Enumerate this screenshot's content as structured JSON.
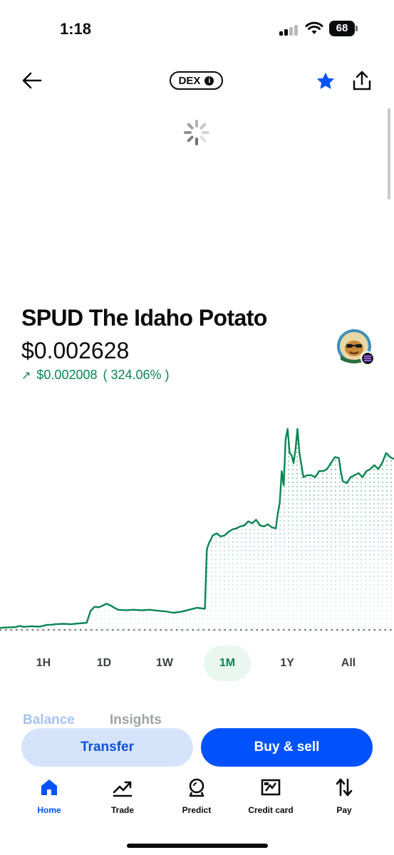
{
  "status_bar": {
    "time": "1:18",
    "battery": "68"
  },
  "header": {
    "badge_label": "DEX",
    "info_glyph": "i",
    "favorite_icon": "star-icon",
    "share_icon": "share-icon",
    "back_icon": "arrow-left-icon"
  },
  "token": {
    "name": "SPUD The Idaho Potato",
    "price": "$0.002628",
    "change_arrow": "↗",
    "change_amount": "$0.002008",
    "change_percent": "( 324.06% )",
    "logo_icon": "spud-token-logo-icon",
    "change_color": "#098551"
  },
  "chart_data": {
    "type": "area",
    "line_color": "#098551",
    "baseline": "dotted",
    "points": [
      [
        0,
        0.01
      ],
      [
        2,
        0.012
      ],
      [
        4,
        0.014
      ],
      [
        5,
        0.02
      ],
      [
        6,
        0.015
      ],
      [
        8,
        0.018
      ],
      [
        10,
        0.016
      ],
      [
        12,
        0.025
      ],
      [
        13,
        0.025
      ],
      [
        14,
        0.028
      ],
      [
        16,
        0.03
      ],
      [
        18,
        0.028
      ],
      [
        20,
        0.032
      ],
      [
        22,
        0.035
      ],
      [
        23,
        0.095
      ],
      [
        24,
        0.115
      ],
      [
        25,
        0.112
      ],
      [
        26,
        0.12
      ],
      [
        27,
        0.13
      ],
      [
        28,
        0.122
      ],
      [
        29,
        0.11
      ],
      [
        30,
        0.1
      ],
      [
        32,
        0.098
      ],
      [
        34,
        0.1
      ],
      [
        36,
        0.097
      ],
      [
        38,
        0.1
      ],
      [
        40,
        0.095
      ],
      [
        42,
        0.092
      ],
      [
        44,
        0.085
      ],
      [
        46,
        0.09
      ],
      [
        48,
        0.1
      ],
      [
        50,
        0.11
      ],
      [
        52,
        0.105
      ],
      [
        52.5,
        0.4
      ],
      [
        53,
        0.43
      ],
      [
        53.5,
        0.45
      ],
      [
        54,
        0.47
      ],
      [
        55,
        0.48
      ],
      [
        56,
        0.465
      ],
      [
        57,
        0.47
      ],
      [
        58,
        0.488
      ],
      [
        59,
        0.5
      ],
      [
        60,
        0.505
      ],
      [
        61,
        0.515
      ],
      [
        62,
        0.52
      ],
      [
        63,
        0.54
      ],
      [
        64,
        0.53
      ],
      [
        65,
        0.548
      ],
      [
        66,
        0.52
      ],
      [
        67,
        0.515
      ],
      [
        68,
        0.525
      ],
      [
        69,
        0.51
      ],
      [
        70,
        0.505
      ],
      [
        70.5,
        0.58
      ],
      [
        71,
        0.63
      ],
      [
        71.5,
        0.79
      ],
      [
        72,
        0.72
      ],
      [
        72.5,
        0.95
      ],
      [
        73,
        1.0
      ],
      [
        73.5,
        0.88
      ],
      [
        74,
        0.87
      ],
      [
        74.5,
        0.83
      ],
      [
        75,
        0.9
      ],
      [
        75.5,
        1.0
      ],
      [
        76,
        0.88
      ],
      [
        77,
        0.76
      ],
      [
        78,
        0.77
      ],
      [
        79,
        0.77
      ],
      [
        80,
        0.76
      ],
      [
        81,
        0.79
      ],
      [
        82,
        0.79
      ],
      [
        83,
        0.8
      ],
      [
        84,
        0.83
      ],
      [
        85,
        0.86
      ],
      [
        86,
        0.855
      ],
      [
        86.5,
        0.79
      ],
      [
        87,
        0.74
      ],
      [
        88,
        0.73
      ],
      [
        89,
        0.76
      ],
      [
        90,
        0.77
      ],
      [
        91,
        0.78
      ],
      [
        92,
        0.76
      ],
      [
        93,
        0.79
      ],
      [
        94,
        0.8
      ],
      [
        95,
        0.82
      ],
      [
        96,
        0.8
      ],
      [
        97,
        0.83
      ],
      [
        98,
        0.88
      ],
      [
        99,
        0.86
      ],
      [
        100,
        0.85
      ]
    ]
  },
  "ranges": [
    "1H",
    "1D",
    "1W",
    "1M",
    "1Y",
    "All"
  ],
  "active_range": "1M",
  "tabs": {
    "balance": "Balance",
    "insights": "Insights"
  },
  "actions": {
    "transfer": "Transfer",
    "buy_sell": "Buy & sell"
  },
  "nav": [
    {
      "label": "Home",
      "icon": "home-icon",
      "active": true
    },
    {
      "label": "Trade",
      "icon": "trend-up-icon",
      "active": false
    },
    {
      "label": "Predict",
      "icon": "crystal-ball-icon",
      "active": false
    },
    {
      "label": "Credit card",
      "icon": "credit-card-icon",
      "active": false
    },
    {
      "label": "Pay",
      "icon": "transfer-arrows-icon",
      "active": false
    }
  ],
  "colors": {
    "brand_blue": "#0052ff",
    "green": "#098551"
  }
}
